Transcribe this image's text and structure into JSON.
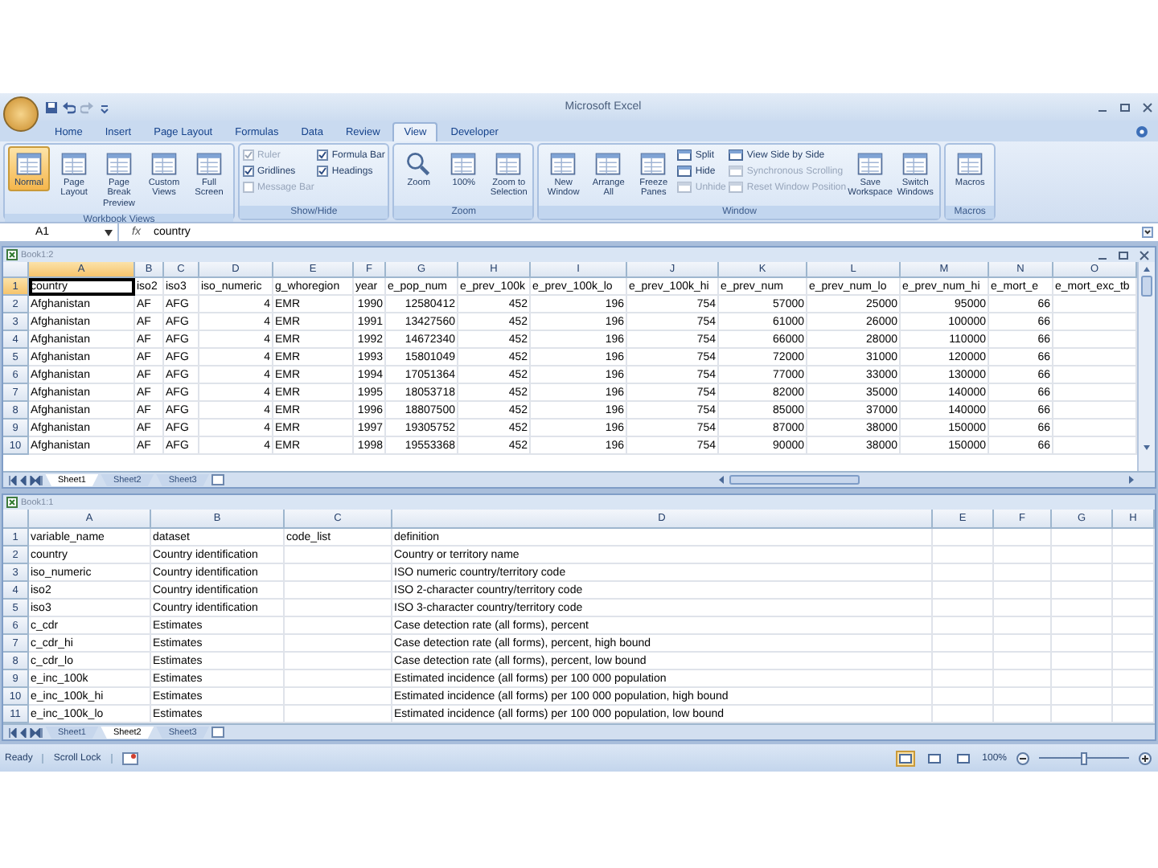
{
  "title_bar": {
    "title": "Microsoft Excel"
  },
  "ribbon_tabs": [
    {
      "label": "Home",
      "selected": false
    },
    {
      "label": "Insert",
      "selected": false
    },
    {
      "label": "Page Layout",
      "selected": false
    },
    {
      "label": "Formulas",
      "selected": false
    },
    {
      "label": "Data",
      "selected": false
    },
    {
      "label": "Review",
      "selected": false
    },
    {
      "label": "View",
      "selected": true
    },
    {
      "label": "Developer",
      "selected": false
    }
  ],
  "ribbon_groups": [
    {
      "title": "Workbook Views",
      "items": [
        {
          "kind": "large",
          "label": "Normal",
          "selected": true
        },
        {
          "kind": "large",
          "label": "Page Layout",
          "selected": false
        },
        {
          "kind": "large",
          "label": "Page Break Preview",
          "selected": false
        },
        {
          "kind": "large",
          "label": "Custom Views",
          "selected": false
        },
        {
          "kind": "large",
          "label": "Full Screen",
          "selected": false
        }
      ]
    },
    {
      "title": "Show/Hide",
      "items": [
        {
          "kind": "column",
          "items": [
            {
              "kind": "check",
              "label": "Ruler",
              "checked": true,
              "disabled": true
            },
            {
              "kind": "check",
              "label": "Gridlines",
              "checked": true,
              "disabled": false
            },
            {
              "kind": "check",
              "label": "Message Bar",
              "checked": false,
              "disabled": true
            }
          ]
        },
        {
          "kind": "column",
          "items": [
            {
              "kind": "check",
              "label": "Formula Bar",
              "checked": true,
              "disabled": false
            },
            {
              "kind": "check",
              "label": "Headings",
              "checked": true,
              "disabled": false
            }
          ]
        }
      ]
    },
    {
      "title": "Zoom",
      "items": [
        {
          "kind": "large",
          "label": "Zoom",
          "selected": false
        },
        {
          "kind": "large",
          "label": "100%",
          "selected": false
        },
        {
          "kind": "large",
          "label": "Zoom to Selection",
          "selected": false
        }
      ]
    },
    {
      "title": "Window",
      "items": [
        {
          "kind": "large",
          "label": "New Window",
          "selected": false
        },
        {
          "kind": "large",
          "label": "Arrange All",
          "selected": false
        },
        {
          "kind": "large",
          "label": "Freeze Panes",
          "selected": false
        },
        {
          "kind": "column",
          "items": [
            {
              "kind": "small",
              "label": "Split",
              "disabled": false
            },
            {
              "kind": "small",
              "label": "Hide",
              "disabled": false
            },
            {
              "kind": "small",
              "label": "Unhide",
              "disabled": true
            }
          ]
        },
        {
          "kind": "column",
          "items": [
            {
              "kind": "small",
              "label": "View Side by Side",
              "disabled": false
            },
            {
              "kind": "small",
              "label": "Synchronous Scrolling",
              "disabled": true
            },
            {
              "kind": "small",
              "label": "Reset Window Position",
              "disabled": true
            }
          ]
        },
        {
          "kind": "large",
          "label": "Save Workspace",
          "selected": false
        },
        {
          "kind": "large",
          "label": "Switch Windows",
          "selected": false
        }
      ]
    },
    {
      "title": "Macros",
      "items": [
        {
          "kind": "large",
          "label": "Macros",
          "selected": false
        }
      ]
    }
  ],
  "formula_bar": {
    "name_box": "A1",
    "function_label": "fx",
    "formula": "country"
  },
  "windows": [
    {
      "title": "Book1:2",
      "columns": [
        {
          "label": "A",
          "selected": true
        },
        {
          "label": "B",
          "selected": false
        },
        {
          "label": "C",
          "selected": false
        },
        {
          "label": "D",
          "selected": false
        },
        {
          "label": "E",
          "selected": false
        },
        {
          "label": "F",
          "selected": false
        },
        {
          "label": "G",
          "selected": false
        },
        {
          "label": "H",
          "selected": false
        },
        {
          "label": "I",
          "selected": false
        },
        {
          "label": "J",
          "selected": false
        },
        {
          "label": "K",
          "selected": false
        },
        {
          "label": "L",
          "selected": false
        },
        {
          "label": "M",
          "selected": false
        },
        {
          "label": "N",
          "selected": false
        },
        {
          "label": "O",
          "selected": false
        }
      ],
      "rows": [
        {
          "header": "1",
          "selected": true,
          "cells": [
            "country",
            "iso2",
            "iso3",
            "iso_numeric",
            "g_whoregion",
            "year",
            "e_pop_num",
            "e_prev_100k",
            "e_prev_100k_lo",
            "e_prev_100k_hi",
            "e_prev_num",
            "e_prev_num_lo",
            "e_prev_num_hi",
            "e_mort_e",
            "e_mort_exc_tb"
          ]
        },
        {
          "header": "2",
          "selected": false,
          "cells": [
            "Afghanistan",
            "AF",
            "AFG",
            "4",
            "EMR",
            "1990",
            "12580412",
            "452",
            "196",
            "754",
            "57000",
            "25000",
            "95000",
            "66",
            ""
          ]
        },
        {
          "header": "3",
          "selected": false,
          "cells": [
            "Afghanistan",
            "AF",
            "AFG",
            "4",
            "EMR",
            "1991",
            "13427560",
            "452",
            "196",
            "754",
            "61000",
            "26000",
            "100000",
            "66",
            ""
          ]
        },
        {
          "header": "4",
          "selected": false,
          "cells": [
            "Afghanistan",
            "AF",
            "AFG",
            "4",
            "EMR",
            "1992",
            "14672340",
            "452",
            "196",
            "754",
            "66000",
            "28000",
            "110000",
            "66",
            ""
          ]
        },
        {
          "header": "5",
          "selected": false,
          "cells": [
            "Afghanistan",
            "AF",
            "AFG",
            "4",
            "EMR",
            "1993",
            "15801049",
            "452",
            "196",
            "754",
            "72000",
            "31000",
            "120000",
            "66",
            ""
          ]
        },
        {
          "header": "6",
          "selected": false,
          "cells": [
            "Afghanistan",
            "AF",
            "AFG",
            "4",
            "EMR",
            "1994",
            "17051364",
            "452",
            "196",
            "754",
            "77000",
            "33000",
            "130000",
            "66",
            ""
          ]
        },
        {
          "header": "7",
          "selected": false,
          "cells": [
            "Afghanistan",
            "AF",
            "AFG",
            "4",
            "EMR",
            "1995",
            "18053718",
            "452",
            "196",
            "754",
            "82000",
            "35000",
            "140000",
            "66",
            ""
          ]
        },
        {
          "header": "8",
          "selected": false,
          "cells": [
            "Afghanistan",
            "AF",
            "AFG",
            "4",
            "EMR",
            "1996",
            "18807500",
            "452",
            "196",
            "754",
            "85000",
            "37000",
            "140000",
            "66",
            ""
          ]
        },
        {
          "header": "9",
          "selected": false,
          "cells": [
            "Afghanistan",
            "AF",
            "AFG",
            "4",
            "EMR",
            "1997",
            "19305752",
            "452",
            "196",
            "754",
            "87000",
            "38000",
            "150000",
            "66",
            ""
          ]
        },
        {
          "header": "10",
          "selected": false,
          "cells": [
            "Afghanistan",
            "AF",
            "AFG",
            "4",
            "EMR",
            "1998",
            "19553368",
            "452",
            "196",
            "754",
            "90000",
            "38000",
            "150000",
            "66",
            ""
          ]
        }
      ],
      "sheet_tabs": [
        {
          "label": "Sheet1",
          "selected": true
        },
        {
          "label": "Sheet2",
          "selected": false
        },
        {
          "label": "Sheet3",
          "selected": false
        }
      ]
    },
    {
      "title": "Book1:1",
      "columns": [
        {
          "label": "A",
          "selected": false
        },
        {
          "label": "B",
          "selected": false
        },
        {
          "label": "C",
          "selected": false
        },
        {
          "label": "D",
          "selected": false
        },
        {
          "label": "E",
          "selected": false
        },
        {
          "label": "F",
          "selected": false
        },
        {
          "label": "G",
          "selected": false
        },
        {
          "label": "H",
          "selected": false
        }
      ],
      "rows": [
        {
          "header": "1",
          "selected": false,
          "cells": [
            "variable_name",
            "dataset",
            "code_list",
            "definition",
            "",
            "",
            "",
            ""
          ]
        },
        {
          "header": "2",
          "selected": false,
          "cells": [
            "country",
            "Country identification",
            "",
            "Country or territory name",
            "",
            "",
            "",
            ""
          ]
        },
        {
          "header": "3",
          "selected": false,
          "cells": [
            "iso_numeric",
            "Country identification",
            "",
            "ISO numeric country/territory code",
            "",
            "",
            "",
            ""
          ]
        },
        {
          "header": "4",
          "selected": false,
          "cells": [
            "iso2",
            "Country identification",
            "",
            "ISO 2-character country/territory code",
            "",
            "",
            "",
            ""
          ]
        },
        {
          "header": "5",
          "selected": false,
          "cells": [
            "iso3",
            "Country identification",
            "",
            "ISO 3-character country/territory code",
            "",
            "",
            "",
            ""
          ]
        },
        {
          "header": "6",
          "selected": false,
          "cells": [
            "c_cdr",
            "Estimates",
            "",
            "Case detection rate (all forms), percent",
            "",
            "",
            "",
            ""
          ]
        },
        {
          "header": "7",
          "selected": false,
          "cells": [
            "c_cdr_hi",
            "Estimates",
            "",
            "Case detection rate (all forms), percent, high bound",
            "",
            "",
            "",
            ""
          ]
        },
        {
          "header": "8",
          "selected": false,
          "cells": [
            "c_cdr_lo",
            "Estimates",
            "",
            "Case detection rate (all forms), percent, low bound",
            "",
            "",
            "",
            ""
          ]
        },
        {
          "header": "9",
          "selected": false,
          "cells": [
            "e_inc_100k",
            "Estimates",
            "",
            "Estimated incidence (all forms) per 100 000 population",
            "",
            "",
            "",
            ""
          ]
        },
        {
          "header": "10",
          "selected": false,
          "cells": [
            "e_inc_100k_hi",
            "Estimates",
            "",
            "Estimated incidence (all forms) per 100 000 population, high bound",
            "",
            "",
            "",
            ""
          ]
        },
        {
          "header": "11",
          "selected": false,
          "cells": [
            "e_inc_100k_lo",
            "Estimates",
            "",
            "Estimated incidence (all forms) per 100 000 population, low bound",
            "",
            "",
            "",
            ""
          ]
        }
      ],
      "sheet_tabs": [
        {
          "label": "Sheet1",
          "selected": false
        },
        {
          "label": "Sheet2",
          "selected": true
        },
        {
          "label": "Sheet3",
          "selected": false
        }
      ]
    }
  ],
  "status_bar": {
    "status": "Ready",
    "scroll_lock": "Scroll Lock",
    "view_buttons": [
      {
        "selected": true
      },
      {
        "selected": false
      },
      {
        "selected": false
      }
    ],
    "zoom": "100%",
    "zoom_slider": {
      "level": 0.5
    }
  }
}
